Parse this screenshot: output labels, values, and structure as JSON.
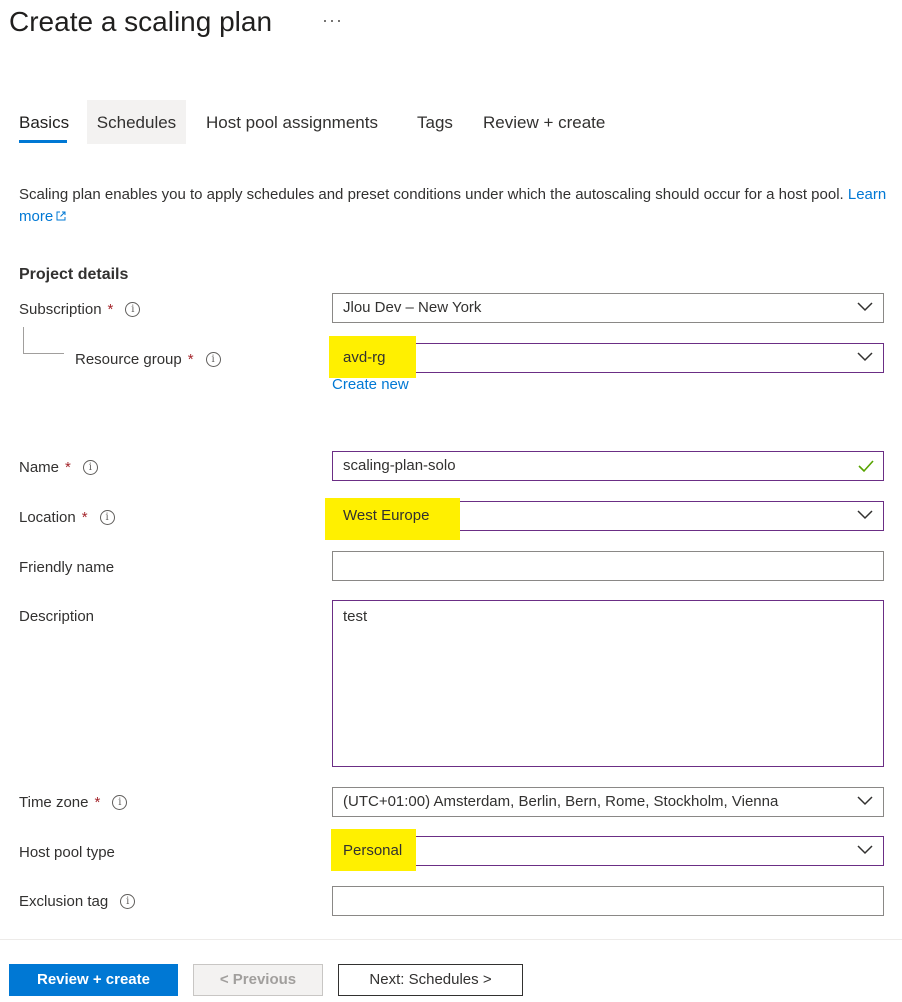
{
  "page": {
    "title": "Create a scaling plan",
    "more_glyph": "···"
  },
  "tabs": [
    {
      "label": "Basics",
      "active": true
    },
    {
      "label": "Schedules",
      "active": false
    },
    {
      "label": "Host pool assignments",
      "active": false
    },
    {
      "label": "Tags",
      "active": false
    },
    {
      "label": "Review + create",
      "active": false
    }
  ],
  "intro": {
    "text": "Scaling plan enables you to apply schedules and preset conditions under which the autoscaling should occur for a host pool.",
    "learn_more": "Learn more"
  },
  "project_details": {
    "heading": "Project details",
    "subscription": {
      "label": "Subscription",
      "required_mark": "*",
      "value": "Jlou Dev – New York"
    },
    "resource_group": {
      "label": "Resource group",
      "required_mark": "*",
      "value": "avd-rg",
      "create_new": "Create new"
    }
  },
  "form": {
    "name": {
      "label": "Name",
      "required_mark": "*",
      "value": "scaling-plan-solo"
    },
    "location": {
      "label": "Location",
      "required_mark": "*",
      "value": "West Europe"
    },
    "friendly_name": {
      "label": "Friendly name",
      "value": ""
    },
    "description": {
      "label": "Description",
      "value": "test"
    },
    "time_zone": {
      "label": "Time zone",
      "required_mark": "*",
      "value": "(UTC+01:00) Amsterdam, Berlin, Bern, Rome, Stockholm, Vienna"
    },
    "host_pool_type": {
      "label": "Host pool type",
      "value": "Personal"
    },
    "exclusion_tag": {
      "label": "Exclusion tag",
      "value": ""
    }
  },
  "footer": {
    "review_create": "Review + create",
    "previous": "< Previous",
    "next": "Next: Schedules >"
  },
  "colors": {
    "accent": "#0078d4",
    "highlight": "#ffef00",
    "required": "#a4262c",
    "focus_border": "#6b2e85",
    "valid_check": "#57a300"
  },
  "icons": {
    "more": "ellipsis-icon",
    "info": "info-icon",
    "dropdown": "chevron-down-icon",
    "valid": "checkmark-icon",
    "external": "external-link-icon"
  }
}
